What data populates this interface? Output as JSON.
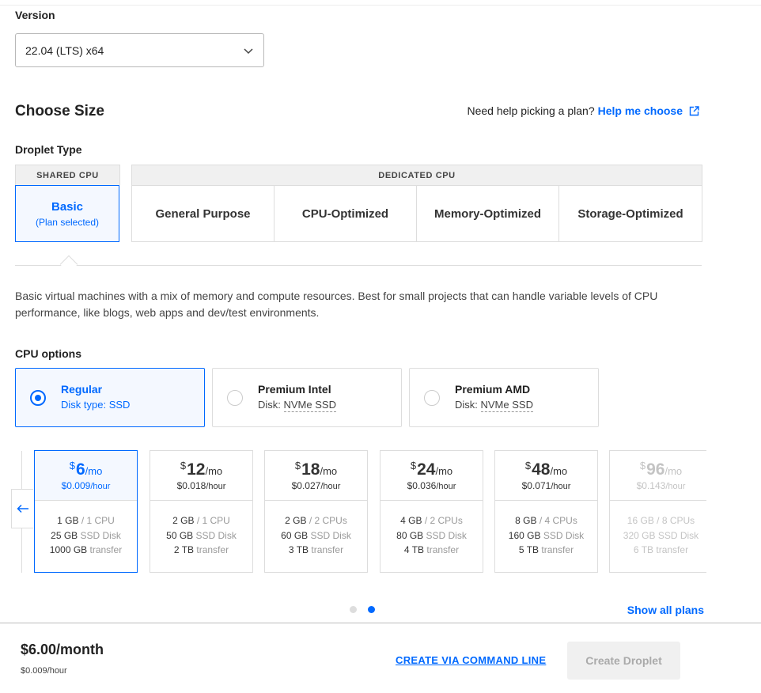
{
  "version": {
    "label": "Version",
    "value": "22.04 (LTS) x64"
  },
  "size": {
    "heading": "Choose Size",
    "help_text": "Need help picking a plan?",
    "help_link": "Help me choose"
  },
  "droplet_type": {
    "label": "Droplet Type",
    "shared_header": "SHARED CPU",
    "dedicated_header": "DEDICATED CPU",
    "basic_title": "Basic",
    "basic_sub": "(Plan selected)",
    "dedicated": [
      "General Purpose",
      "CPU-Optimized",
      "Memory-Optimized",
      "Storage-Optimized"
    ]
  },
  "description": "Basic virtual machines with a mix of memory and compute resources. Best for small projects that can handle variable levels of CPU performance, like blogs, web apps and dev/test environments.",
  "cpu_options": {
    "label": "CPU options",
    "items": [
      {
        "name": "Regular",
        "disk_prefix": "Disk type: ",
        "disk": "SSD",
        "selected": true
      },
      {
        "name": "Premium Intel",
        "disk_prefix": "Disk: ",
        "disk": "NVMe SSD",
        "selected": false
      },
      {
        "name": "Premium AMD",
        "disk_prefix": "Disk: ",
        "disk": "NVMe SSD",
        "selected": false
      }
    ]
  },
  "plans": [
    {
      "cur": "$",
      "price": "6",
      "per": "/mo",
      "hourly": "$0.009",
      "hr_unit": "/hour",
      "mem": "1 GB",
      "cpu": " / 1 CPU",
      "disk": "25 GB",
      "disk_t": " SSD Disk",
      "xfer": "1000 GB",
      "xfer_t": " transfer"
    },
    {
      "cur": "$",
      "price": "12",
      "per": "/mo",
      "hourly": "$0.018",
      "hr_unit": "/hour",
      "mem": "2 GB",
      "cpu": " / 1 CPU",
      "disk": "50 GB",
      "disk_t": " SSD Disk",
      "xfer": "2 TB",
      "xfer_t": " transfer"
    },
    {
      "cur": "$",
      "price": "18",
      "per": "/mo",
      "hourly": "$0.027",
      "hr_unit": "/hour",
      "mem": "2 GB",
      "cpu": " / 2 CPUs",
      "disk": "60 GB",
      "disk_t": " SSD Disk",
      "xfer": "3 TB",
      "xfer_t": " transfer"
    },
    {
      "cur": "$",
      "price": "24",
      "per": "/mo",
      "hourly": "$0.036",
      "hr_unit": "/hour",
      "mem": "4 GB",
      "cpu": " / 2 CPUs",
      "disk": "80 GB",
      "disk_t": " SSD Disk",
      "xfer": "4 TB",
      "xfer_t": " transfer"
    },
    {
      "cur": "$",
      "price": "48",
      "per": "/mo",
      "hourly": "$0.071",
      "hr_unit": "/hour",
      "mem": "8 GB",
      "cpu": " / 4 CPUs",
      "disk": "160 GB",
      "disk_t": " SSD Disk",
      "xfer": "5 TB",
      "xfer_t": " transfer"
    },
    {
      "cur": "$",
      "price": "96",
      "per": "/mo",
      "hourly": "$0.143",
      "hr_unit": "/hour",
      "mem": "16 GB",
      "cpu": " / 8 CPUs",
      "disk": "320 GB",
      "disk_t": " SSD Disk",
      "xfer": "6 TB",
      "xfer_t": " transfer"
    }
  ],
  "show_all": "Show all plans",
  "footer": {
    "price": "$6.00/month",
    "hourly": "$0.009/hour",
    "cli": "CREATE VIA COMMAND LINE",
    "create": "Create Droplet"
  },
  "colors": {
    "accent": "#0069ff"
  }
}
